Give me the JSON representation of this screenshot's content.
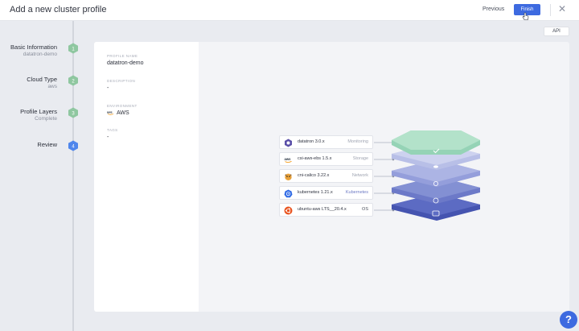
{
  "header": {
    "title": "Add a new cluster profile",
    "previous_label": "Previous",
    "finish_label": "Finish",
    "close_icon": "close-icon"
  },
  "steps": [
    {
      "number": "1",
      "label": "Basic Information",
      "sub": "datatron-demo"
    },
    {
      "number": "2",
      "label": "Cloud Type",
      "sub": "aws"
    },
    {
      "number": "3",
      "label": "Profile Layers",
      "sub": "Complete"
    },
    {
      "number": "4",
      "label": "Review",
      "sub": ""
    }
  ],
  "api_label": "API",
  "summary": {
    "profile_name_label": "PROFILE NAME",
    "profile_name": "datatron-demo",
    "description_label": "DESCRIPTION",
    "description": "-",
    "environment_label": "ENVIRONMENT",
    "environment": "AWS",
    "tags_label": "TAGS",
    "tags": "-"
  },
  "layers": [
    {
      "name": "datatron 3.0.x",
      "type": "Monitoring",
      "icon": "datatron-icon"
    },
    {
      "name": "csi-aws-ebs 1.5.x",
      "type": "Storage",
      "icon": "aws-icon"
    },
    {
      "name": "cni-calico 3.22.x",
      "type": "Network",
      "icon": "calico-icon"
    },
    {
      "name": "kubernetes 1.21.x",
      "type": "Kubernetes",
      "icon": "kubernetes-icon"
    },
    {
      "name": "ubuntu-aws LTS__20.4.x",
      "type": "OS",
      "icon": "ubuntu-icon"
    }
  ],
  "colors": {
    "accent": "#3d6ae0",
    "step_complete": "#8fc7a0",
    "layer_monitoring": "#a9dcc3",
    "layer_storage": "#c3c8ea",
    "layer_network": "#a7b0e0",
    "layer_kubernetes": "#7c88d1",
    "layer_os": "#5362bb"
  },
  "help_label": "?"
}
